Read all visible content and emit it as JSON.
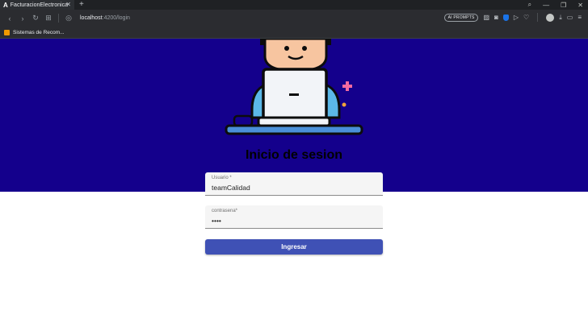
{
  "browser": {
    "tab_title": "FacturacionElectronica",
    "tab_favicon_letter": "A",
    "new_tab": "+",
    "address": {
      "host": "localhost",
      "path": ":4200/login"
    },
    "ai_prompts_label": "AI PROMPTS",
    "bookmark_label": "Sistemas de Recom..."
  },
  "page": {
    "title": "Inicio de sesion",
    "username": {
      "label": "Usuario *",
      "value": "teamCalidad"
    },
    "password": {
      "label": "contrasena*",
      "value": "••••"
    },
    "submit_label": "Ingresar"
  },
  "colors": {
    "hero_bg": "#14008c",
    "button_bg": "#3f51b5"
  }
}
